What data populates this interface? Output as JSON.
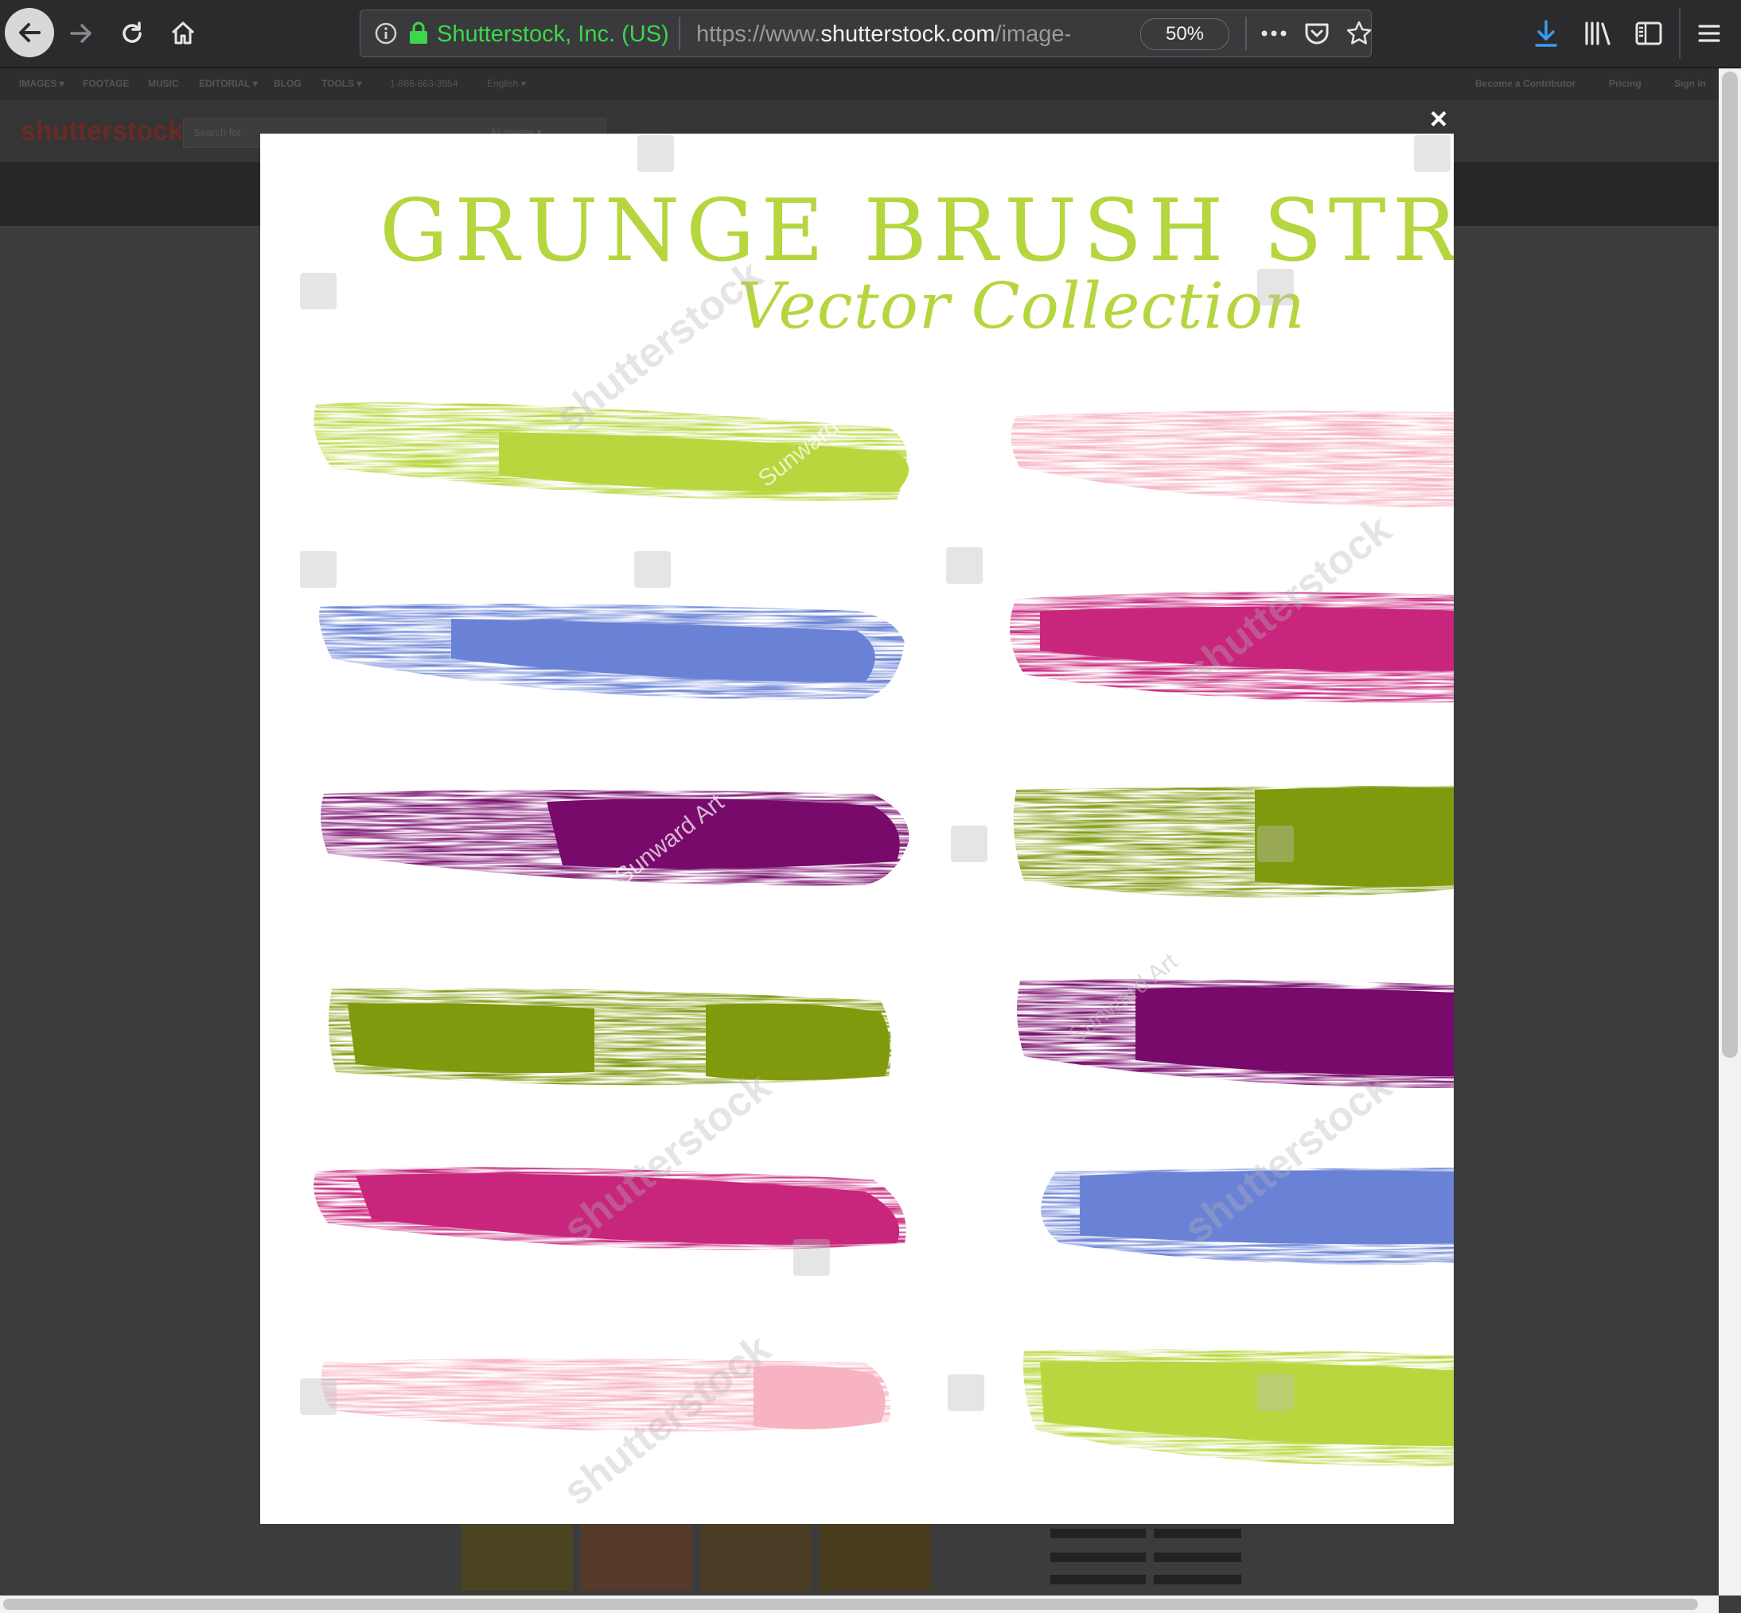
{
  "browser": {
    "site_identity": "Shutterstock, Inc. (US)",
    "url_prefix": "https://www.",
    "url_domain": "shutterstock.com",
    "url_suffix": "/image-",
    "zoom": "50%",
    "icons": [
      "back-icon",
      "forward-icon",
      "reload-icon",
      "home-icon",
      "info-icon",
      "lock-icon",
      "more-icon",
      "pocket-icon",
      "star-icon",
      "download-icon",
      "library-icon",
      "sidebar-icon",
      "menu-icon"
    ]
  },
  "site": {
    "nav": [
      "IMAGES ▾",
      "FOOTAGE",
      "MUSIC",
      "EDITORIAL ▾",
      "BLOG",
      "TOOLS ▾",
      "1-866-663-3954",
      "English ▾"
    ],
    "nav_right": [
      "Become a Contributor",
      "Pricing",
      "Sign in"
    ],
    "logo": "shutterstock",
    "search_placeholder": "Search for",
    "search_category": "All images ▾"
  },
  "lightbox": {
    "close": "×",
    "title": "GRUNGE BRUSH STROKE",
    "subtitle": "Vector  Collection",
    "watermark": "shutterstock",
    "artist": "Sunward Art",
    "colors": {
      "lime": "#b8d73e",
      "pink": "#f7b3c2",
      "blue": "#6a82d6",
      "magenta": "#c8267d",
      "purple": "#770a6b",
      "olive": "#7f9a0d"
    }
  }
}
